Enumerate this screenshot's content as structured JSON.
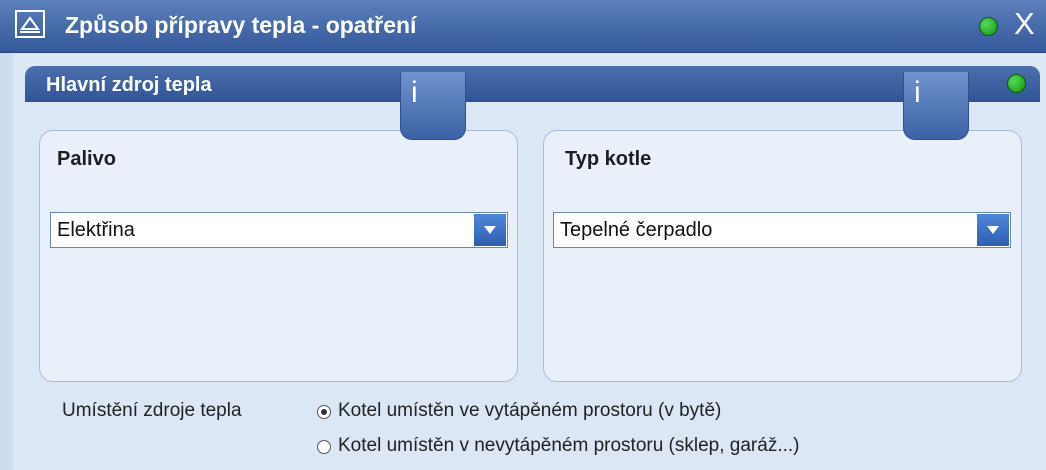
{
  "window": {
    "title": "Způsob přípravy tepla - opatření",
    "close_label": "X"
  },
  "panel": {
    "title": "Hlavní zdroj tepla"
  },
  "info_buttons": [
    {
      "label": "i"
    },
    {
      "label": "i"
    }
  ],
  "fuel": {
    "label": "Palivo",
    "selected": "Elektřina"
  },
  "boiler": {
    "label": "Typ kotle",
    "selected": "Tepelné čerpadlo"
  },
  "location": {
    "label": "Umístění zdroje tepla",
    "options": [
      {
        "label": "Kotel umístěn ve vytápěném prostoru (v bytě)",
        "checked": true
      },
      {
        "label": "Kotel umístěn v nevytápěném prostoru (sklep, garáž...)",
        "checked": false
      }
    ]
  },
  "colors": {
    "title_bar": "#3f63a2",
    "status_green": "#2fae2f",
    "select_arrow": "#3a6fc4"
  }
}
